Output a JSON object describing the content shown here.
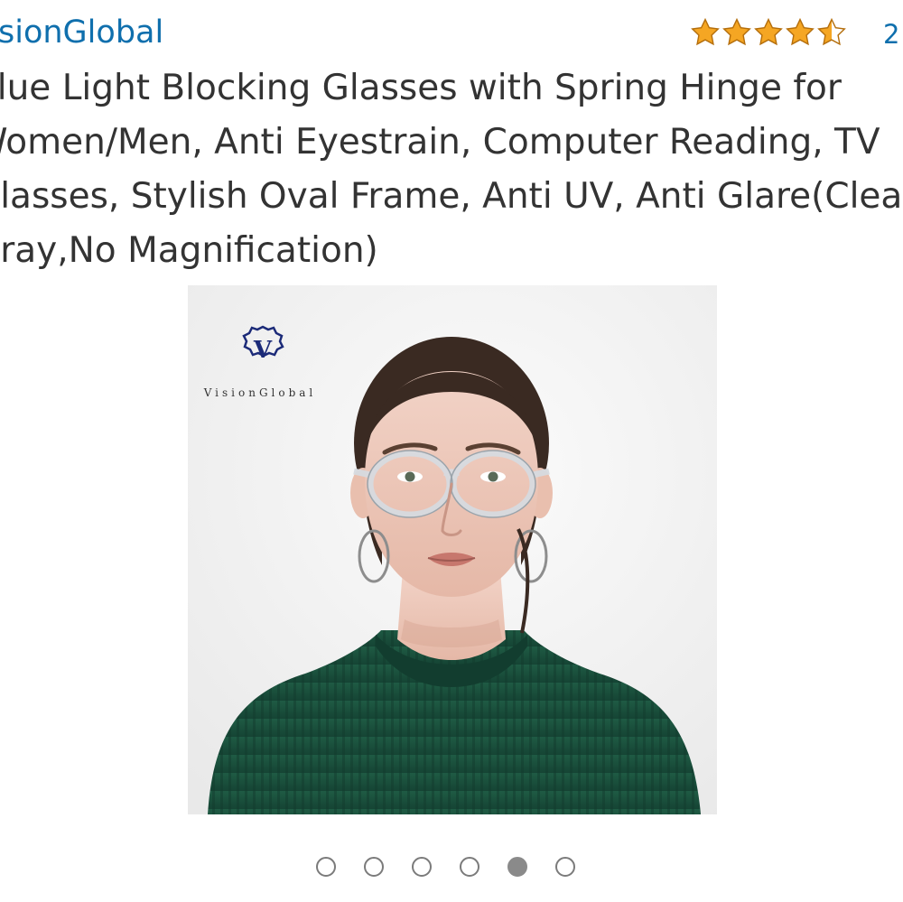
{
  "product": {
    "brand": "VisionGlobal",
    "brand_visible": "sionGlobal",
    "rating_value": 4.5,
    "review_count_visible": "2",
    "title_lines": [
      "Blue Light Blocking Glasses with Spring Hinge for",
      "Women/Men, Anti Eyestrain, Computer Reading, TV",
      "Glasses, Stylish Oval Frame, Anti UV, Anti Glare(Clear",
      "Gray,No Magnification)"
    ],
    "image_logo_text": "VisionGlobal"
  },
  "carousel": {
    "count": 6,
    "active_index": 4
  },
  "colors": {
    "link": "#0f6fad",
    "title": "#333333",
    "star": "#f5a623",
    "dot": "#8a8a8a"
  },
  "icons": {
    "star": "star-icon",
    "dot": "carousel-dot-icon"
  }
}
